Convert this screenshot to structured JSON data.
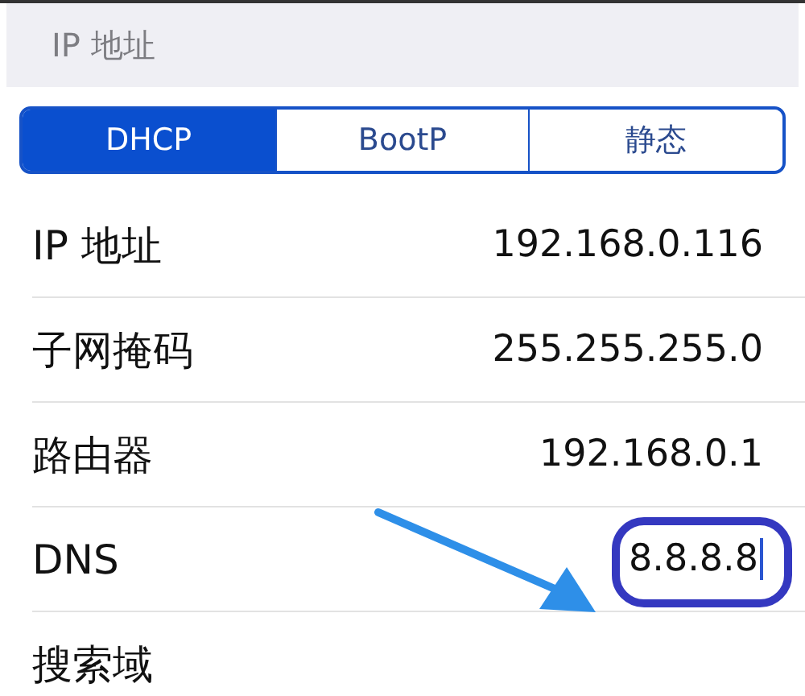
{
  "section_header": "IP 地址",
  "segments": [
    {
      "label": "DHCP",
      "selected": true
    },
    {
      "label": "BootP",
      "selected": false
    },
    {
      "label": "静态",
      "selected": false
    }
  ],
  "rows": [
    {
      "label": "IP 地址",
      "value": "192.168.0.116",
      "editing": false,
      "highlighted": false
    },
    {
      "label": "子网掩码",
      "value": "255.255.255.0",
      "editing": false,
      "highlighted": false
    },
    {
      "label": "路由器",
      "value": "192.168.0.1",
      "editing": false,
      "highlighted": false
    },
    {
      "label": "DNS",
      "value": "8.8.8.8",
      "editing": true,
      "highlighted": true
    },
    {
      "label": "搜索域",
      "editing": false,
      "highlighted": false
    }
  ]
}
